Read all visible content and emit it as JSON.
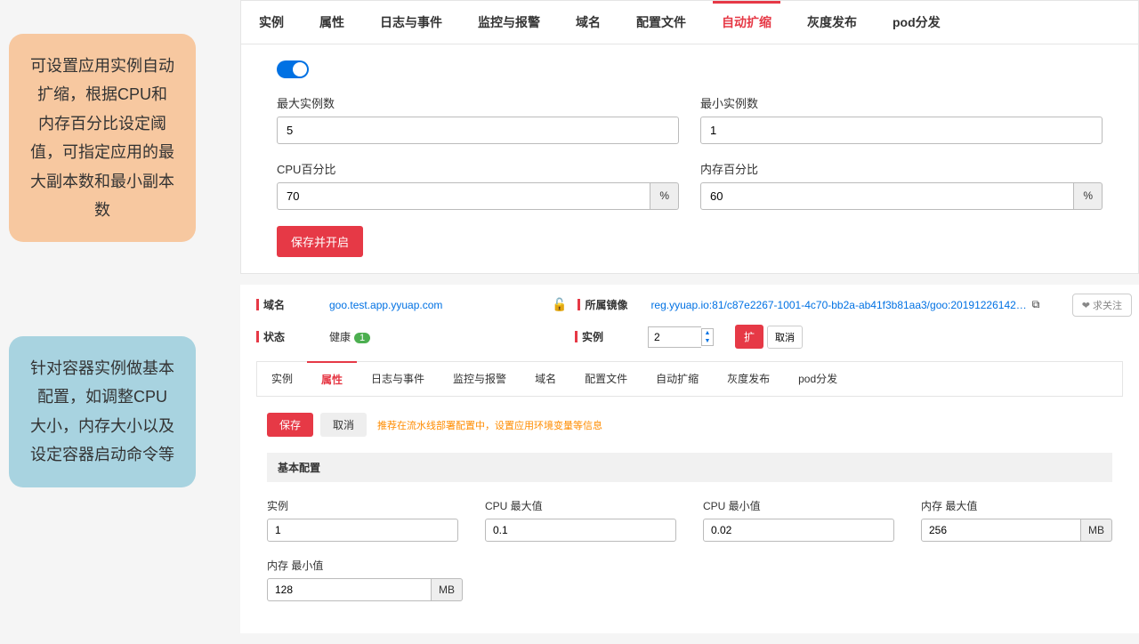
{
  "callouts": {
    "top": "可设置应用实例自动扩缩，根据CPU和内存百分比设定阈值，可指定应用的最大副本数和最小副本数",
    "bottom": "针对容器实例做基本配置，如调整CPU大小，内存大小以及设定容器启动命令等"
  },
  "panel1": {
    "tabs": [
      "实例",
      "属性",
      "日志与事件",
      "监控与报警",
      "域名",
      "配置文件",
      "自动扩缩",
      "灰度发布",
      "pod分发"
    ],
    "active_index": 6,
    "toggle_on": true,
    "fields": {
      "max_label": "最大实例数",
      "max_value": "5",
      "min_label": "最小实例数",
      "min_value": "1",
      "cpu_label": "CPU百分比",
      "cpu_value": "70",
      "cpu_suffix": "%",
      "mem_label": "内存百分比",
      "mem_value": "60",
      "mem_suffix": "%"
    },
    "save_btn": "保存并开启"
  },
  "panel2": {
    "meta": {
      "domain_label": "域名",
      "domain_value": "goo.test.app.yyuap.com",
      "lock_icon": "unlock-icon",
      "image_label": "所属镜像",
      "image_value": "reg.yyuap.io:81/c87e2267-1001-4c70-bb2a-ab41f3b81aa3/goo:20191226142…",
      "status_label": "状态",
      "status_value": "健康",
      "status_badge": "1",
      "instance_label": "实例",
      "instance_value": "2",
      "scale_btn": "扩",
      "cancel_btn": "取消",
      "follow_btn": "求关注"
    },
    "tabs": [
      "实例",
      "属性",
      "日志与事件",
      "监控与报警",
      "域名",
      "配置文件",
      "自动扩缩",
      "灰度发布",
      "pod分发"
    ],
    "active_index": 1,
    "save_btn": "保存",
    "cancel_btn2": "取消",
    "warn_text": "推荐在流水线部署配置中，设置应用环境变量等信息",
    "section_title": "基本配置",
    "fields": {
      "inst_label": "实例",
      "inst_value": "1",
      "cpumax_label": "CPU 最大值",
      "cpumax_value": "0.1",
      "cpumin_label": "CPU 最小值",
      "cpumin_value": "0.02",
      "memmax_label": "内存 最大值",
      "memmax_value": "256",
      "memmin_label": "内存 最小值",
      "memmin_value": "128",
      "mb_suffix": "MB"
    }
  }
}
